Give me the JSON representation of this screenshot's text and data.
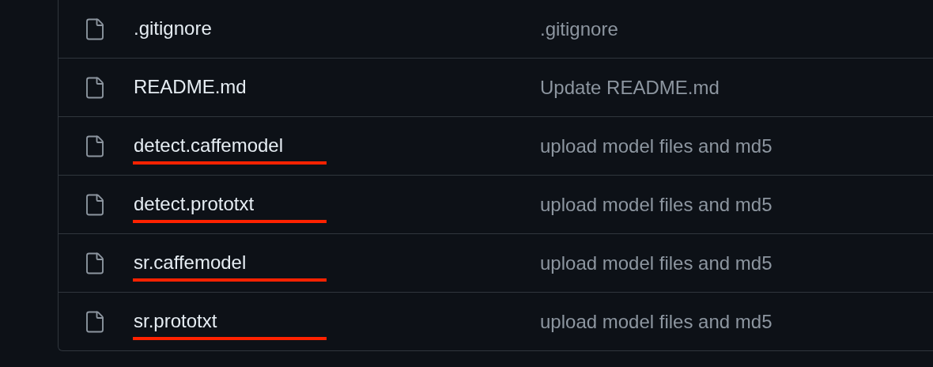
{
  "files": [
    {
      "name": ".gitignore",
      "message": ".gitignore",
      "underlined": false
    },
    {
      "name": "README.md",
      "message": "Update README.md",
      "underlined": false
    },
    {
      "name": "detect.caffemodel",
      "message": "upload model files and md5",
      "underlined": true
    },
    {
      "name": "detect.prototxt",
      "message": "upload model files and md5",
      "underlined": true
    },
    {
      "name": "sr.caffemodel",
      "message": "upload model files and md5",
      "underlined": true
    },
    {
      "name": "sr.prototxt",
      "message": "upload model files and md5",
      "underlined": true
    }
  ]
}
